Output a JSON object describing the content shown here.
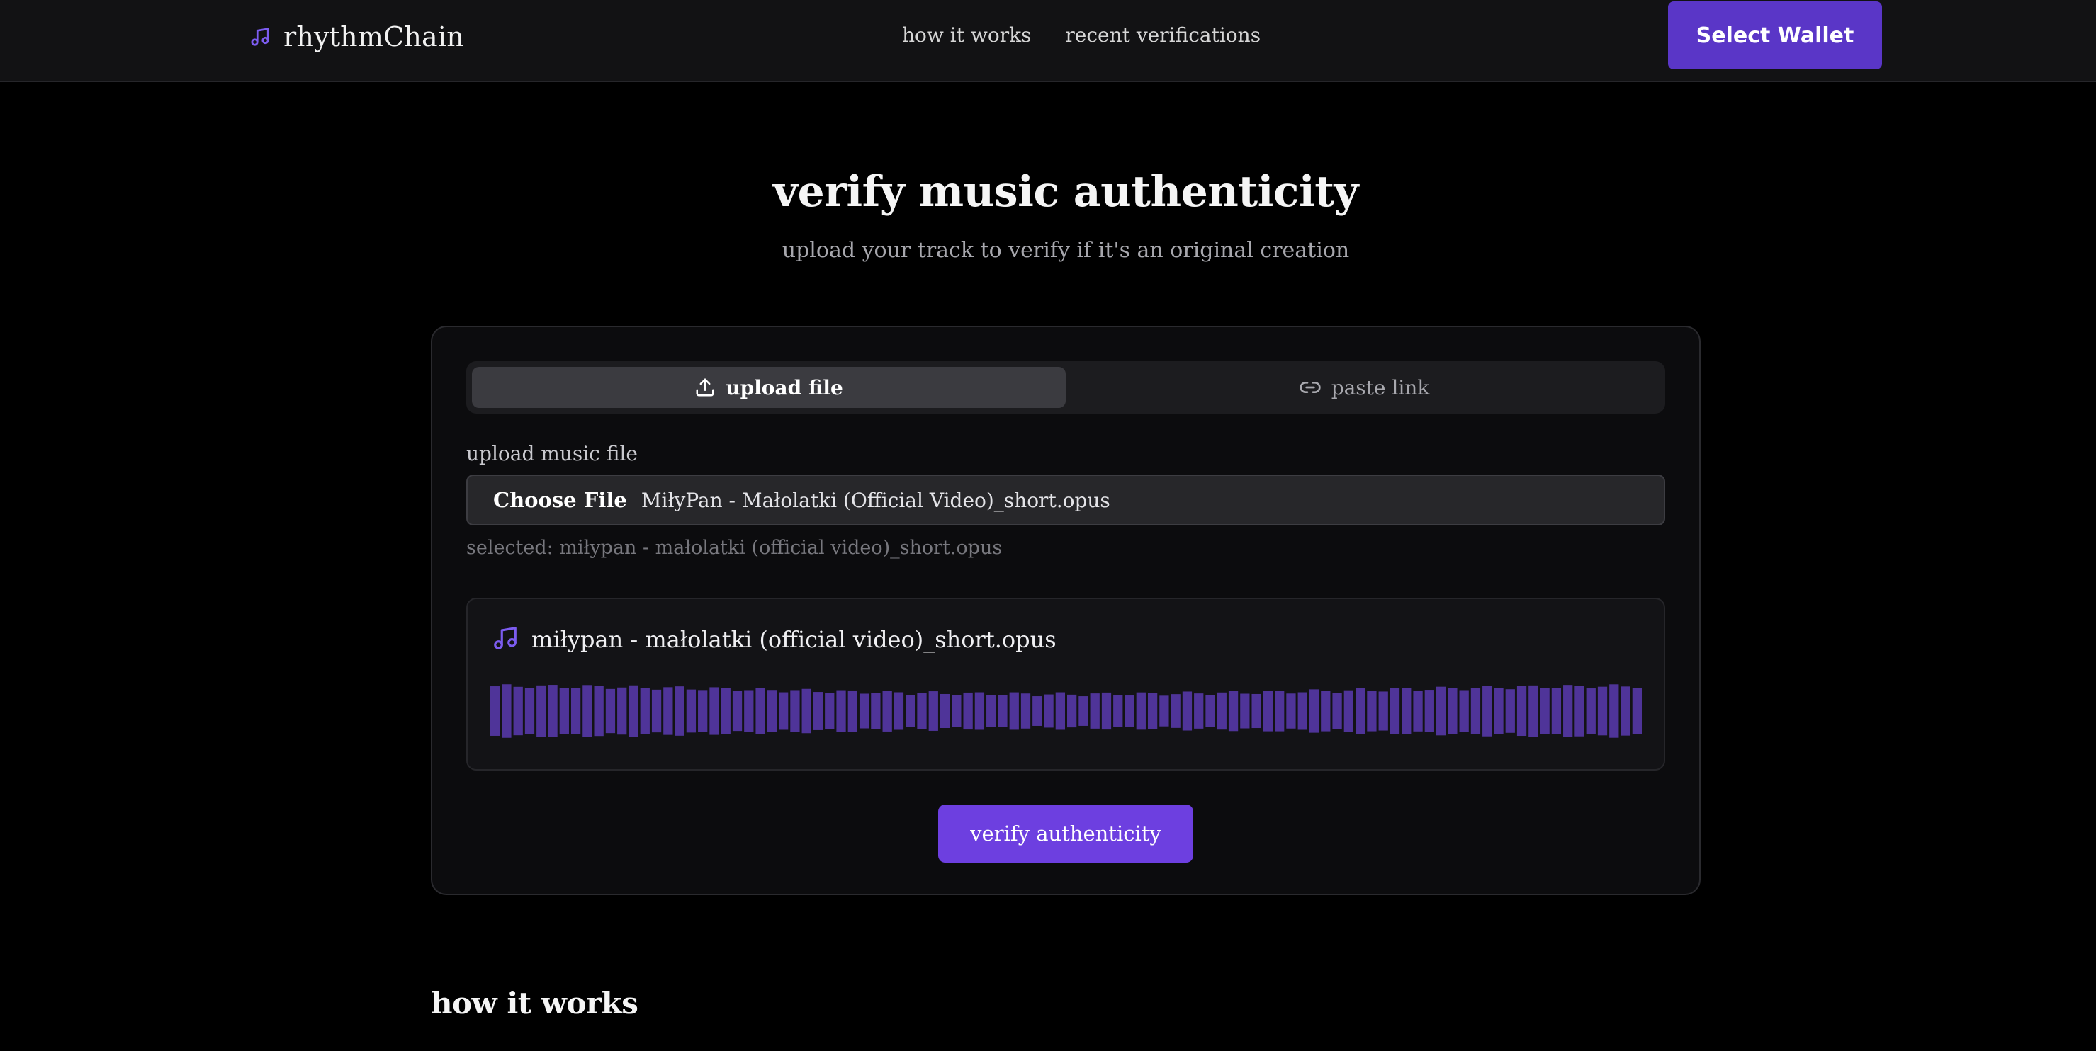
{
  "header": {
    "brand": "rhythmChain",
    "brand_icon": "music-note-icon",
    "nav": [
      {
        "label": "how it works"
      },
      {
        "label": "recent verifications"
      }
    ],
    "wallet_button": "Select Wallet"
  },
  "hero": {
    "title": "verify music authenticity",
    "subtitle": "upload your track to verify if it's an original creation"
  },
  "card": {
    "tabs": [
      {
        "label": "upload file",
        "icon": "upload-icon",
        "active": true
      },
      {
        "label": "paste link",
        "icon": "link-icon",
        "active": false
      }
    ],
    "upload_label": "upload music file",
    "file_input": {
      "button_label": "Choose File",
      "file_name": "MiłyPan - Małolatki (Official Video)_short.opus"
    },
    "selected_text": "selected: miłypan - małolatki (official video)_short.opus",
    "preview": {
      "icon": "music-note-icon",
      "file_name": "miłypan - małolatki (official video)_short.opus"
    },
    "verify_button": "verify authenticity"
  },
  "sections": {
    "how_it_works_title": "how it works"
  },
  "colors": {
    "accent": "#6d3fe0",
    "wallet_button": "#5a36c7",
    "waveform": "#5b3bb0",
    "background": "#000000",
    "card": "#0c0c0e"
  }
}
